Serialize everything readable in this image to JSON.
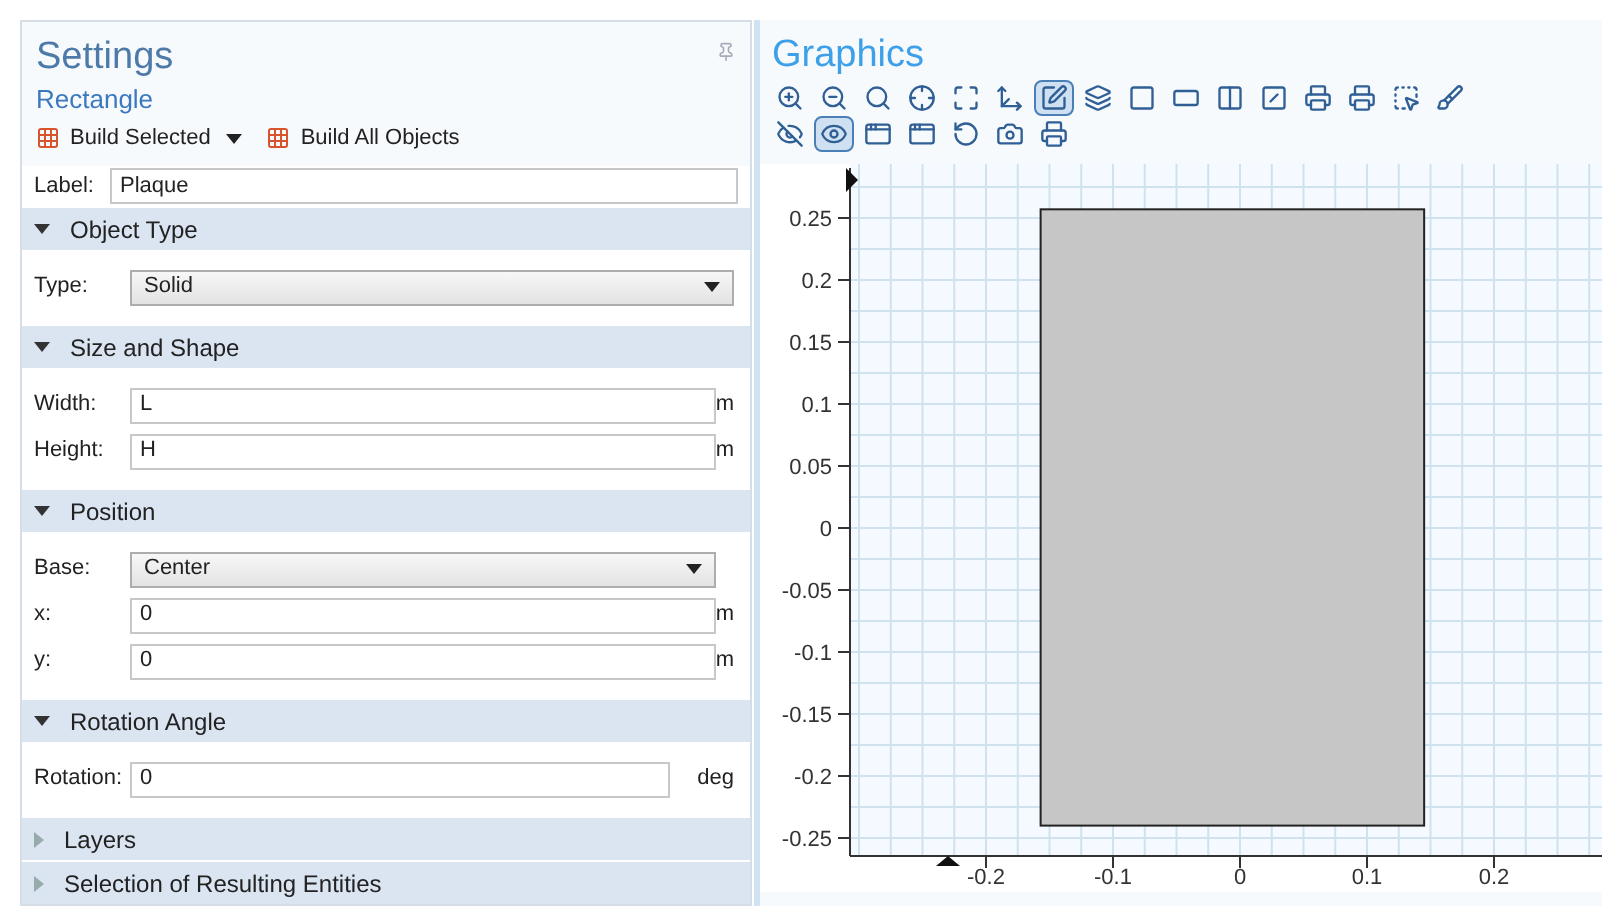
{
  "settings": {
    "title": "Settings",
    "subtitle": "Rectangle",
    "build_buttons": [
      {
        "label": "Build Selected",
        "dropdown": true
      },
      {
        "label": "Build All Objects",
        "dropdown": false
      }
    ],
    "label_field": {
      "label": "Label:",
      "value": "Plaque"
    },
    "sections": [
      {
        "title": "Object Type",
        "expanded": true,
        "fields": [
          {
            "kind": "select",
            "label": "Type:",
            "value": "Solid"
          }
        ]
      },
      {
        "title": "Size and Shape",
        "expanded": true,
        "fields": [
          {
            "kind": "input",
            "label": "Width:",
            "value": "L",
            "unit": "m"
          },
          {
            "kind": "input",
            "label": "Height:",
            "value": "H",
            "unit": "m"
          }
        ]
      },
      {
        "title": "Position",
        "expanded": true,
        "fields": [
          {
            "kind": "select",
            "label": "Base:",
            "value": "Center"
          },
          {
            "kind": "input",
            "label": "x:",
            "value": "0",
            "unit": "m"
          },
          {
            "kind": "input",
            "label": "y:",
            "value": "0",
            "unit": "m"
          }
        ]
      },
      {
        "title": "Rotation Angle",
        "expanded": true,
        "fields": [
          {
            "kind": "input",
            "label": "Rotation:",
            "value": "0",
            "unit": "deg"
          }
        ]
      },
      {
        "title": "Layers",
        "expanded": false
      },
      {
        "title": "Selection of Resulting Entities",
        "expanded": false
      }
    ]
  },
  "graphics": {
    "title": "Graphics",
    "toolbar_rows": [
      [
        {
          "selected": false
        },
        {
          "selected": false
        },
        {
          "selected": false
        },
        {
          "selected": false
        },
        {
          "selected": false
        },
        {
          "selected": false
        },
        {
          "selected": true
        },
        {
          "selected": false
        },
        {
          "selected": false
        },
        {
          "selected": false
        },
        {
          "selected": false
        },
        {
          "selected": false
        },
        {
          "selected": false
        },
        {
          "selected": false
        },
        {
          "selected": false
        },
        {
          "selected": false
        }
      ],
      [
        {
          "selected": false
        },
        {
          "selected": true
        },
        {
          "selected": false
        },
        {
          "selected": false
        },
        {
          "selected": false
        },
        {
          "selected": false
        },
        {
          "selected": false
        }
      ]
    ],
    "y_ticks": [
      "0.25",
      "0.2",
      "0.15",
      "0.1",
      "0.05",
      "0",
      "-0.05",
      "-0.1",
      "-0.15",
      "-0.2",
      "-0.25"
    ],
    "x_ticks": [
      "-0.2",
      "-0.1",
      "0",
      "0.1",
      "0.2"
    ]
  }
}
